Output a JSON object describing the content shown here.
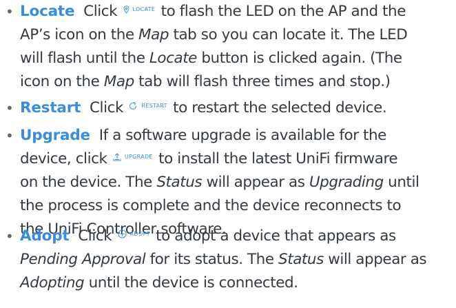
{
  "items": [
    {
      "term": "Locate",
      "before": "Click",
      "button": {
        "icon": "location-pin-icon",
        "label": "LOCATE"
      },
      "l1": "to flash the LED on the AP and the",
      "l2": "AP’s icon on the",
      "l2_em": "Map",
      "l2_end": "tab so you can locate it. The LED",
      "l3a": "will flash until the",
      "l3_em": "Locate",
      "l3b": "button is clicked again. (The",
      "l4a": "icon on the",
      "l4_em": "Map",
      "l4b": "tab will flash three times and stop.)"
    },
    {
      "term": "Restart",
      "before": "Click",
      "button": {
        "icon": "refresh-icon",
        "label": "RESTART"
      },
      "l1": "to restart the selected device."
    },
    {
      "term": "Upgrade",
      "l1": "If a software upgrade is available for the",
      "l2a": "device, click",
      "button": {
        "icon": "upload-icon",
        "label": "UPGRADE"
      },
      "l2b": "to install the latest UniFi firmware",
      "l3a": "on the device. The",
      "l3_em1": "Status",
      "l3b": "will appear as",
      "l3_em2": "Upgrading",
      "l3c": "until",
      "l4": "the process is complete and the device reconnects to",
      "l5": "the UniFi Controller software."
    },
    {
      "term": "Adopt",
      "before": "Click",
      "button": {
        "icon": "plus-circle-icon",
        "label": "ADOPT"
      },
      "l1": "to adopt a device that appears as",
      "l2_em1": "Pending Approval",
      "l2a": "for its status. The",
      "l2_em2": "Status",
      "l2b": "will appear as",
      "l3_em": "Adopting",
      "l3": "until the device is connected."
    }
  ],
  "colors": {
    "accent": "#3a8dde",
    "text": "#333a40"
  }
}
